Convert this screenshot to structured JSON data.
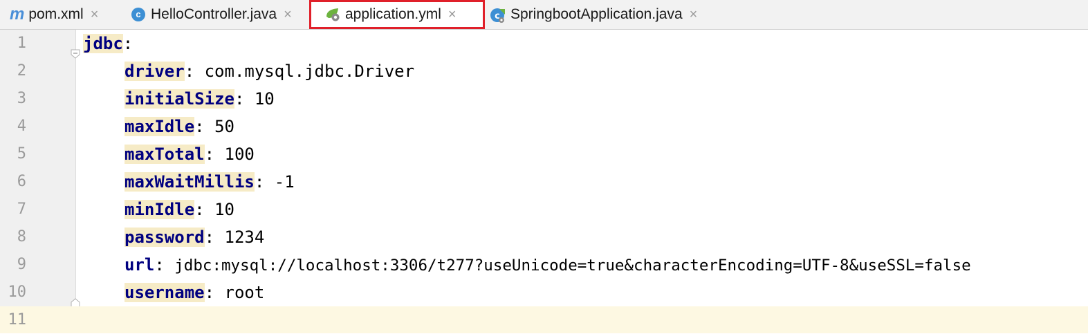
{
  "tabs": [
    {
      "label": "pom.xml",
      "icon": "maven-icon"
    },
    {
      "label": "HelloController.java",
      "icon": "java-class-icon"
    },
    {
      "label": "application.yml",
      "icon": "spring-config-icon"
    },
    {
      "label": "SpringbootApplication.java",
      "icon": "spring-boot-class-icon"
    }
  ],
  "tab_close_glyph": "×",
  "icon_glyphs": {
    "maven": "m",
    "java_class": "c"
  },
  "colors": {
    "highlight_border": "#e0202a",
    "yaml_key": "#000080",
    "key_highlight": "#f6ebc6",
    "current_line": "#fdf8e2"
  },
  "editor": {
    "lines": [
      {
        "num": "1",
        "key": "jdbc",
        "sep": ":",
        "value": ""
      },
      {
        "num": "2",
        "key": "driver",
        "sep": ": ",
        "value": "com.mysql.jdbc.Driver"
      },
      {
        "num": "3",
        "key": "initialSize",
        "sep": ": ",
        "value": "10"
      },
      {
        "num": "4",
        "key": "maxIdle",
        "sep": ": ",
        "value": "50"
      },
      {
        "num": "5",
        "key": "maxTotal",
        "sep": ": ",
        "value": "100"
      },
      {
        "num": "6",
        "key": "maxWaitMillis",
        "sep": ": ",
        "value": "-1"
      },
      {
        "num": "7",
        "key": "minIdle",
        "sep": ": ",
        "value": "10"
      },
      {
        "num": "8",
        "key": "password",
        "sep": ": ",
        "value": "1234"
      },
      {
        "num": "9",
        "key": "url",
        "sep": ": ",
        "value": "jdbc:mysql://localhost:3306/t277?useUnicode=true&characterEncoding=UTF-8&useSSL=false"
      },
      {
        "num": "10",
        "key": "username",
        "sep": ": ",
        "value": "root"
      },
      {
        "num": "11",
        "key": "",
        "sep": "",
        "value": ""
      }
    ]
  }
}
